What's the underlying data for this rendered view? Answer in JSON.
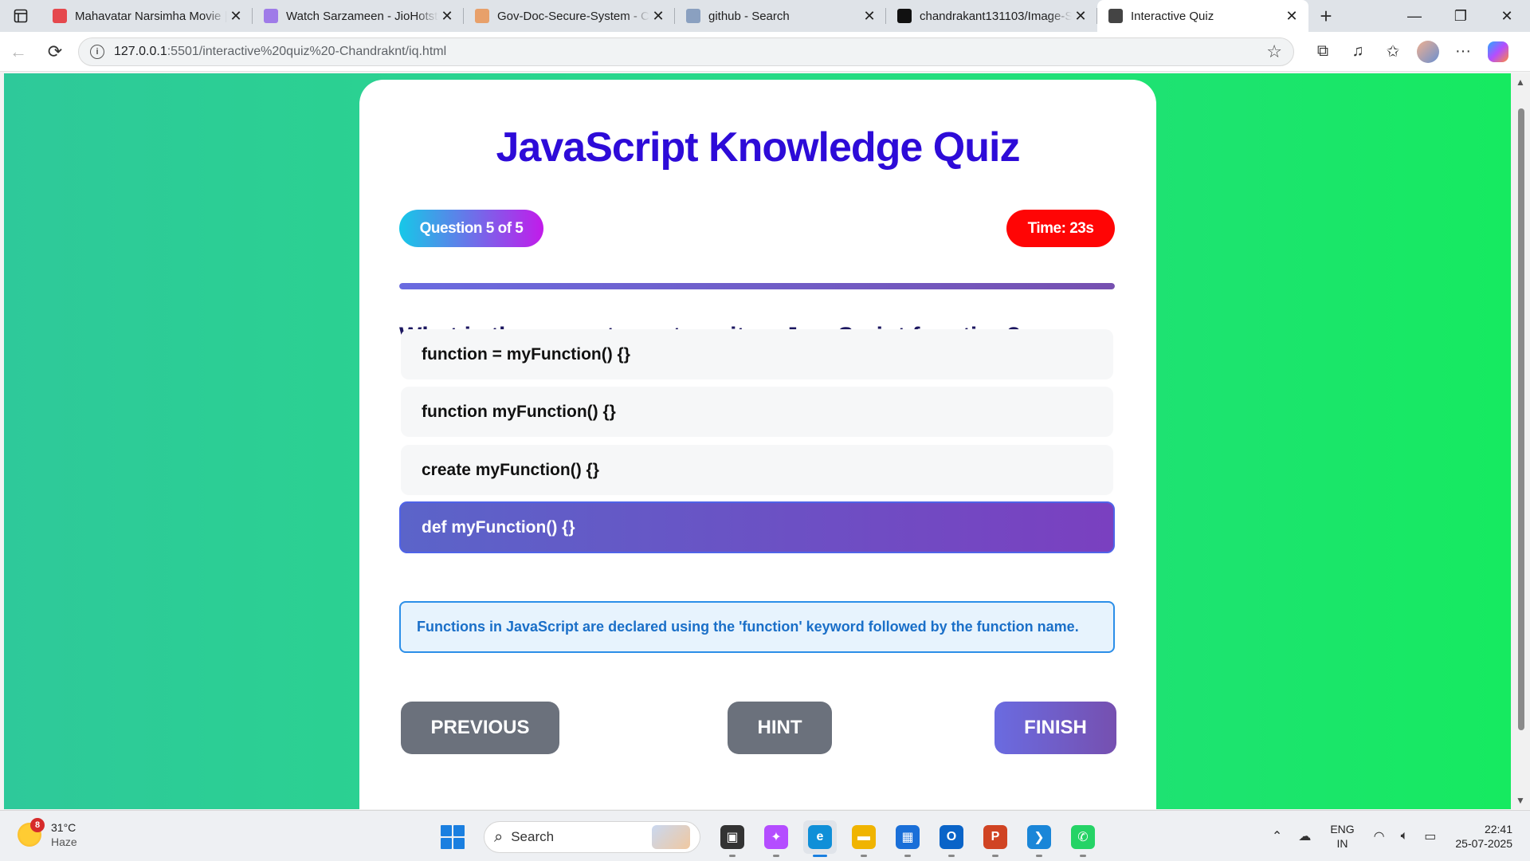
{
  "browser": {
    "tabs": [
      {
        "title": "Mahavatar Narsimha Movie |",
        "favicon_color": "#e5484d",
        "icon": "youtube-icon",
        "active": false
      },
      {
        "title": "Watch Sarzameen - JioHotst",
        "favicon_color": "#9f7be8",
        "icon": "jiohotstar-icon",
        "active": false
      },
      {
        "title": "Gov-Doc-Secure-System - Cl",
        "favicon_color": "#e8a06a",
        "icon": "claude-icon",
        "active": false
      },
      {
        "title": "github - Search",
        "favicon_color": "#8aa0c0",
        "icon": "search-icon",
        "active": false
      },
      {
        "title": "chandrakant131103/Image-S",
        "favicon_color": "#111111",
        "icon": "github-icon",
        "active": false
      },
      {
        "title": "Interactive Quiz",
        "favicon_color": "#444444",
        "icon": "globe-icon",
        "active": true
      }
    ],
    "url_host": "127.0.0.1",
    "url_rest": ":5501/interactive%20quiz%20-Chandraknt/iq.html"
  },
  "quiz": {
    "title": "JavaScript Knowledge Quiz",
    "question_counter": "Question 5 of 5",
    "timer": "Time: 23s",
    "progress_fraction": 1.0,
    "question": "What is the correct way to write a JavaScript function?",
    "options": [
      {
        "text": "function = myFunction() {}",
        "selected": false
      },
      {
        "text": "function myFunction() {}",
        "selected": false
      },
      {
        "text": "create myFunction() {}",
        "selected": false
      },
      {
        "text": "def myFunction() {}",
        "selected": true
      }
    ],
    "hint_text": "Functions in JavaScript are declared using the 'function' keyword followed by the function name.",
    "buttons": {
      "previous": "PREVIOUS",
      "hint": "HINT",
      "finish": "FINISH"
    }
  },
  "colors": {
    "title": "#2d0bd8",
    "timer_bg": "#ff0505",
    "selected_option": "#6a52c4",
    "hint_border": "#2b8ee8"
  },
  "taskbar": {
    "weather_badge": "8",
    "temperature": "31°C",
    "condition": "Haze",
    "search_placeholder": "Search",
    "apps": [
      {
        "name": "task-view-icon",
        "color": "#333333",
        "glyph": "▣"
      },
      {
        "name": "copilot-icon",
        "color": "#b44dff",
        "glyph": "✦"
      },
      {
        "name": "edge-icon",
        "color": "#0f8fd8",
        "glyph": "e",
        "active": true
      },
      {
        "name": "file-explorer-icon",
        "color": "#f0b400",
        "glyph": "▬"
      },
      {
        "name": "store-icon",
        "color": "#1a6fd8",
        "glyph": "▦"
      },
      {
        "name": "outlook-icon",
        "color": "#0a64c8",
        "glyph": "O"
      },
      {
        "name": "powerpoint-icon",
        "color": "#d04423",
        "glyph": "P"
      },
      {
        "name": "vscode-icon",
        "color": "#1a86d8",
        "glyph": "❯"
      },
      {
        "name": "whatsapp-icon",
        "color": "#25d366",
        "glyph": "✆"
      }
    ],
    "lang_top": "ENG",
    "lang_bottom": "IN",
    "time": "22:41",
    "date": "25-07-2025"
  }
}
